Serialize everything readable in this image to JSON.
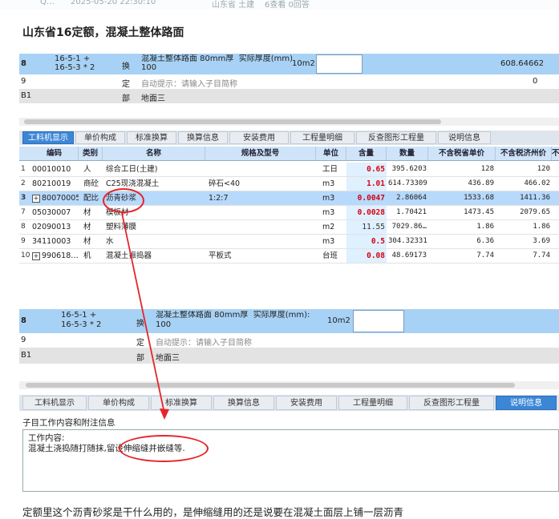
{
  "meta": {
    "user": "Q…",
    "time": "2025-05-20 22:30:10",
    "extra": "山东省 土建",
    "count": "6查看 0回答"
  },
  "title": "山东省16定额，混凝土整体路面",
  "grid_top": {
    "rows": [
      {
        "num": "8",
        "code": "16-5-1 +\n16-5-3 * 2",
        "type": "换",
        "name": "混凝土整体路面 80mm厚  实际厚度(mm):\n100",
        "unit": "10m2",
        "value": "608.64662"
      },
      {
        "num": "9",
        "type": "定",
        "name": "自动提示：请输入子目简称",
        "value": "0"
      },
      {
        "num": "B1",
        "type": "部",
        "name": "地面三"
      }
    ]
  },
  "tabs_top": [
    "工料机显示",
    "单价构成",
    "标准换算",
    "换算信息",
    "安装费用",
    "工程量明细",
    "反查图形工程量",
    "说明信息"
  ],
  "table": {
    "headers": [
      "编码",
      "类别",
      "名称",
      "规格及型号",
      "单位",
      "含量",
      "数量",
      "不含税省单价",
      "不含税济州价",
      "不"
    ],
    "rows": [
      {
        "n": "1",
        "code": "00010010",
        "cat": "人",
        "name": "综合工日(土建)",
        "spec": "",
        "unit": "工日",
        "qty": "0.65",
        "amount": "395.6203",
        "p1": "128",
        "p2": "120"
      },
      {
        "n": "2",
        "code": "80210019",
        "cat": "商砼",
        "name": "C25现浇混凝土",
        "spec": "碎石<40",
        "unit": "m3",
        "qty": "1.01",
        "amount": "614.73309",
        "p1": "436.89",
        "p2": "466.02"
      },
      {
        "n": "3",
        "code": "80070005",
        "cat": "配比",
        "name": "沥青砂浆",
        "spec": "1:2:7",
        "unit": "m3",
        "qty": "0.0047",
        "amount": "2.86064",
        "p1": "1533.68",
        "p2": "1411.36",
        "expand": "+"
      },
      {
        "n": "7",
        "code": "05030007",
        "cat": "材",
        "name": "模板材",
        "spec": "",
        "unit": "m3",
        "qty": "0.0028",
        "amount": "1.70421",
        "p1": "1473.45",
        "p2": "2079.65"
      },
      {
        "n": "8",
        "code": "02090013",
        "cat": "材",
        "name": "塑料薄膜",
        "spec": "",
        "unit": "m2",
        "qty": "11.55",
        "amount": "7029.86…",
        "p1": "1.86",
        "p2": "1.86"
      },
      {
        "n": "9",
        "code": "34110003",
        "cat": "材",
        "name": "水",
        "spec": "",
        "unit": "m3",
        "qty": "0.5",
        "amount": "304.32331",
        "p1": "6.36",
        "p2": "3.69"
      },
      {
        "n": "10",
        "code": "990618…",
        "cat": "机",
        "name": "混凝土振捣器",
        "spec": "平板式",
        "unit": "台班",
        "qty": "0.08",
        "amount": "48.69173",
        "p1": "7.74",
        "p2": "7.74",
        "expand": "+"
      }
    ]
  },
  "grid_bottom": {
    "rows": [
      {
        "num": "8",
        "code": "16-5-1 +\n16-5-3 * 2",
        "type": "换",
        "name": "混凝土整体路面 80mm厚  实际厚度(mm):\n100",
        "unit": "10m2"
      },
      {
        "num": "9",
        "type": "定",
        "name": "自动提示：请输入子目简称"
      },
      {
        "num": "B1",
        "type": "部",
        "name": "地面三"
      }
    ]
  },
  "tabs_bottom": [
    "工料机显示",
    "单价构成",
    "标准换算",
    "换算信息",
    "安装费用",
    "工程量明细",
    "反查图形工程量",
    "说明信息"
  ],
  "note": {
    "heading": "子目工作内容和附注信息",
    "line1": "工作内容:",
    "line2": "混凝土浇捣随打随抹,留设伸缩缝并嵌缝等."
  },
  "question": "定额里这个沥青砂浆是干什么用的，是伸缩缝用的还是说要在混凝土面层上铺一层沥青",
  "colors": {
    "accent": "#3c86d6",
    "row_blue": "#a8d2f5",
    "annotation": "#e5252a",
    "qty_red": "#d8000f"
  }
}
